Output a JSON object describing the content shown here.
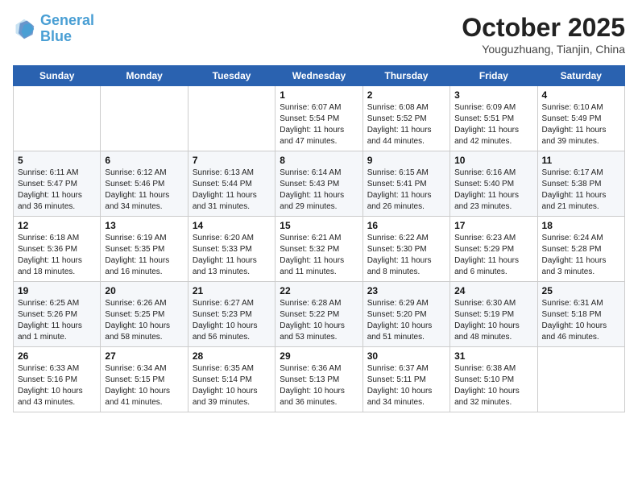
{
  "header": {
    "logo_line1": "General",
    "logo_line2": "Blue",
    "month_title": "October 2025",
    "location": "Youguzhuang, Tianjin, China"
  },
  "weekdays": [
    "Sunday",
    "Monday",
    "Tuesday",
    "Wednesday",
    "Thursday",
    "Friday",
    "Saturday"
  ],
  "weeks": [
    [
      {
        "day": "",
        "info": ""
      },
      {
        "day": "",
        "info": ""
      },
      {
        "day": "",
        "info": ""
      },
      {
        "day": "1",
        "info": "Sunrise: 6:07 AM\nSunset: 5:54 PM\nDaylight: 11 hours\nand 47 minutes."
      },
      {
        "day": "2",
        "info": "Sunrise: 6:08 AM\nSunset: 5:52 PM\nDaylight: 11 hours\nand 44 minutes."
      },
      {
        "day": "3",
        "info": "Sunrise: 6:09 AM\nSunset: 5:51 PM\nDaylight: 11 hours\nand 42 minutes."
      },
      {
        "day": "4",
        "info": "Sunrise: 6:10 AM\nSunset: 5:49 PM\nDaylight: 11 hours\nand 39 minutes."
      }
    ],
    [
      {
        "day": "5",
        "info": "Sunrise: 6:11 AM\nSunset: 5:47 PM\nDaylight: 11 hours\nand 36 minutes."
      },
      {
        "day": "6",
        "info": "Sunrise: 6:12 AM\nSunset: 5:46 PM\nDaylight: 11 hours\nand 34 minutes."
      },
      {
        "day": "7",
        "info": "Sunrise: 6:13 AM\nSunset: 5:44 PM\nDaylight: 11 hours\nand 31 minutes."
      },
      {
        "day": "8",
        "info": "Sunrise: 6:14 AM\nSunset: 5:43 PM\nDaylight: 11 hours\nand 29 minutes."
      },
      {
        "day": "9",
        "info": "Sunrise: 6:15 AM\nSunset: 5:41 PM\nDaylight: 11 hours\nand 26 minutes."
      },
      {
        "day": "10",
        "info": "Sunrise: 6:16 AM\nSunset: 5:40 PM\nDaylight: 11 hours\nand 23 minutes."
      },
      {
        "day": "11",
        "info": "Sunrise: 6:17 AM\nSunset: 5:38 PM\nDaylight: 11 hours\nand 21 minutes."
      }
    ],
    [
      {
        "day": "12",
        "info": "Sunrise: 6:18 AM\nSunset: 5:36 PM\nDaylight: 11 hours\nand 18 minutes."
      },
      {
        "day": "13",
        "info": "Sunrise: 6:19 AM\nSunset: 5:35 PM\nDaylight: 11 hours\nand 16 minutes."
      },
      {
        "day": "14",
        "info": "Sunrise: 6:20 AM\nSunset: 5:33 PM\nDaylight: 11 hours\nand 13 minutes."
      },
      {
        "day": "15",
        "info": "Sunrise: 6:21 AM\nSunset: 5:32 PM\nDaylight: 11 hours\nand 11 minutes."
      },
      {
        "day": "16",
        "info": "Sunrise: 6:22 AM\nSunset: 5:30 PM\nDaylight: 11 hours\nand 8 minutes."
      },
      {
        "day": "17",
        "info": "Sunrise: 6:23 AM\nSunset: 5:29 PM\nDaylight: 11 hours\nand 6 minutes."
      },
      {
        "day": "18",
        "info": "Sunrise: 6:24 AM\nSunset: 5:28 PM\nDaylight: 11 hours\nand 3 minutes."
      }
    ],
    [
      {
        "day": "19",
        "info": "Sunrise: 6:25 AM\nSunset: 5:26 PM\nDaylight: 11 hours\nand 1 minute."
      },
      {
        "day": "20",
        "info": "Sunrise: 6:26 AM\nSunset: 5:25 PM\nDaylight: 10 hours\nand 58 minutes."
      },
      {
        "day": "21",
        "info": "Sunrise: 6:27 AM\nSunset: 5:23 PM\nDaylight: 10 hours\nand 56 minutes."
      },
      {
        "day": "22",
        "info": "Sunrise: 6:28 AM\nSunset: 5:22 PM\nDaylight: 10 hours\nand 53 minutes."
      },
      {
        "day": "23",
        "info": "Sunrise: 6:29 AM\nSunset: 5:20 PM\nDaylight: 10 hours\nand 51 minutes."
      },
      {
        "day": "24",
        "info": "Sunrise: 6:30 AM\nSunset: 5:19 PM\nDaylight: 10 hours\nand 48 minutes."
      },
      {
        "day": "25",
        "info": "Sunrise: 6:31 AM\nSunset: 5:18 PM\nDaylight: 10 hours\nand 46 minutes."
      }
    ],
    [
      {
        "day": "26",
        "info": "Sunrise: 6:33 AM\nSunset: 5:16 PM\nDaylight: 10 hours\nand 43 minutes."
      },
      {
        "day": "27",
        "info": "Sunrise: 6:34 AM\nSunset: 5:15 PM\nDaylight: 10 hours\nand 41 minutes."
      },
      {
        "day": "28",
        "info": "Sunrise: 6:35 AM\nSunset: 5:14 PM\nDaylight: 10 hours\nand 39 minutes."
      },
      {
        "day": "29",
        "info": "Sunrise: 6:36 AM\nSunset: 5:13 PM\nDaylight: 10 hours\nand 36 minutes."
      },
      {
        "day": "30",
        "info": "Sunrise: 6:37 AM\nSunset: 5:11 PM\nDaylight: 10 hours\nand 34 minutes."
      },
      {
        "day": "31",
        "info": "Sunrise: 6:38 AM\nSunset: 5:10 PM\nDaylight: 10 hours\nand 32 minutes."
      },
      {
        "day": "",
        "info": ""
      }
    ]
  ]
}
